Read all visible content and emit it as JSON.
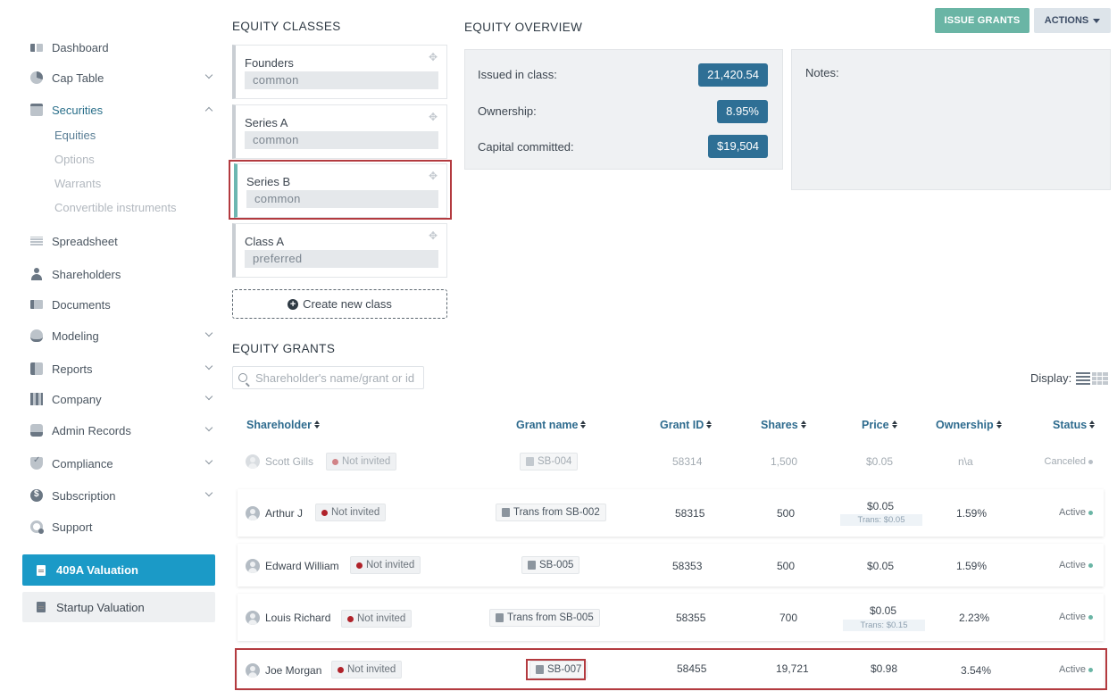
{
  "sidebar": {
    "items": [
      {
        "label": "Dashboard",
        "icon": "dashboard-icon"
      },
      {
        "label": "Cap Table",
        "icon": "pie-chart-icon"
      },
      {
        "label": "Securities",
        "icon": "clipboard-icon"
      },
      {
        "label": "Spreadsheet",
        "icon": "spreadsheet-icon"
      },
      {
        "label": "Shareholders",
        "icon": "user-icon"
      },
      {
        "label": "Documents",
        "icon": "folder-icon"
      },
      {
        "label": "Modeling",
        "icon": "lightbulb-icon"
      },
      {
        "label": "Reports",
        "icon": "report-icon"
      },
      {
        "label": "Company",
        "icon": "building-icon"
      },
      {
        "label": "Admin Records",
        "icon": "admin-icon"
      },
      {
        "label": "Compliance",
        "icon": "shield-icon"
      },
      {
        "label": "Subscription",
        "icon": "coin-icon"
      },
      {
        "label": "Support",
        "icon": "support-icon"
      }
    ],
    "securities_sub": [
      "Equities",
      "Options",
      "Warrants",
      "Convertible instruments"
    ],
    "valuation_409a": "409A Valuation",
    "startup_valuation": "Startup Valuation"
  },
  "equity_classes": {
    "title": "EQUITY CLASSES",
    "classes": [
      {
        "name": "Founders",
        "type": "common"
      },
      {
        "name": "Series A",
        "type": "common"
      },
      {
        "name": "Series B",
        "type": "common"
      },
      {
        "name": "Class A",
        "type": "preferred"
      }
    ],
    "create_label": "Create new class"
  },
  "overview": {
    "title": "EQUITY OVERVIEW",
    "issued_label": "Issued in class:",
    "issued_value": "21,420.54",
    "ownership_label": "Ownership:",
    "ownership_value": "8.95%",
    "capital_label": "Capital committed:",
    "capital_value": "$19,504",
    "notes_label": "Notes:"
  },
  "toolbar": {
    "issue_grants": "ISSUE GRANTS",
    "actions": "ACTIONS"
  },
  "grants": {
    "title": "EQUITY GRANTS",
    "search_placeholder": "Shareholder's name/grant or id",
    "display_label": "Display:",
    "columns": {
      "shareholder": "Shareholder",
      "grant_name": "Grant name",
      "grant_id": "Grant ID",
      "shares": "Shares",
      "price": "Price",
      "ownership": "Ownership",
      "status": "Status"
    },
    "rows": [
      {
        "name": "Scott Gills",
        "invite": "Not invited",
        "grant": "SB-004",
        "id": "58314",
        "shares": "1,500",
        "price": "$0.05",
        "trans": "",
        "ownership": "n\\a",
        "status": "Canceled"
      },
      {
        "name": "Arthur J",
        "invite": "Not invited",
        "grant": "Trans from SB-002",
        "id": "58315",
        "shares": "500",
        "price": "$0.05",
        "trans": "Trans: $0.05",
        "ownership": "1.59%",
        "status": "Active"
      },
      {
        "name": "Edward William",
        "invite": "Not invited",
        "grant": "SB-005",
        "id": "58353",
        "shares": "500",
        "price": "$0.05",
        "trans": "",
        "ownership": "1.59%",
        "status": "Active"
      },
      {
        "name": "Louis Richard",
        "invite": "Not invited",
        "grant": "Trans from SB-005",
        "id": "58355",
        "shares": "700",
        "price": "$0.05",
        "trans": "Trans: $0.15",
        "ownership": "2.23%",
        "status": "Active"
      },
      {
        "name": "Joe Morgan",
        "invite": "Not invited",
        "grant": "SB-007",
        "id": "58455",
        "shares": "19,721",
        "price": "$0.98",
        "trans": "",
        "ownership": "3.54%",
        "status": "Active"
      }
    ]
  }
}
